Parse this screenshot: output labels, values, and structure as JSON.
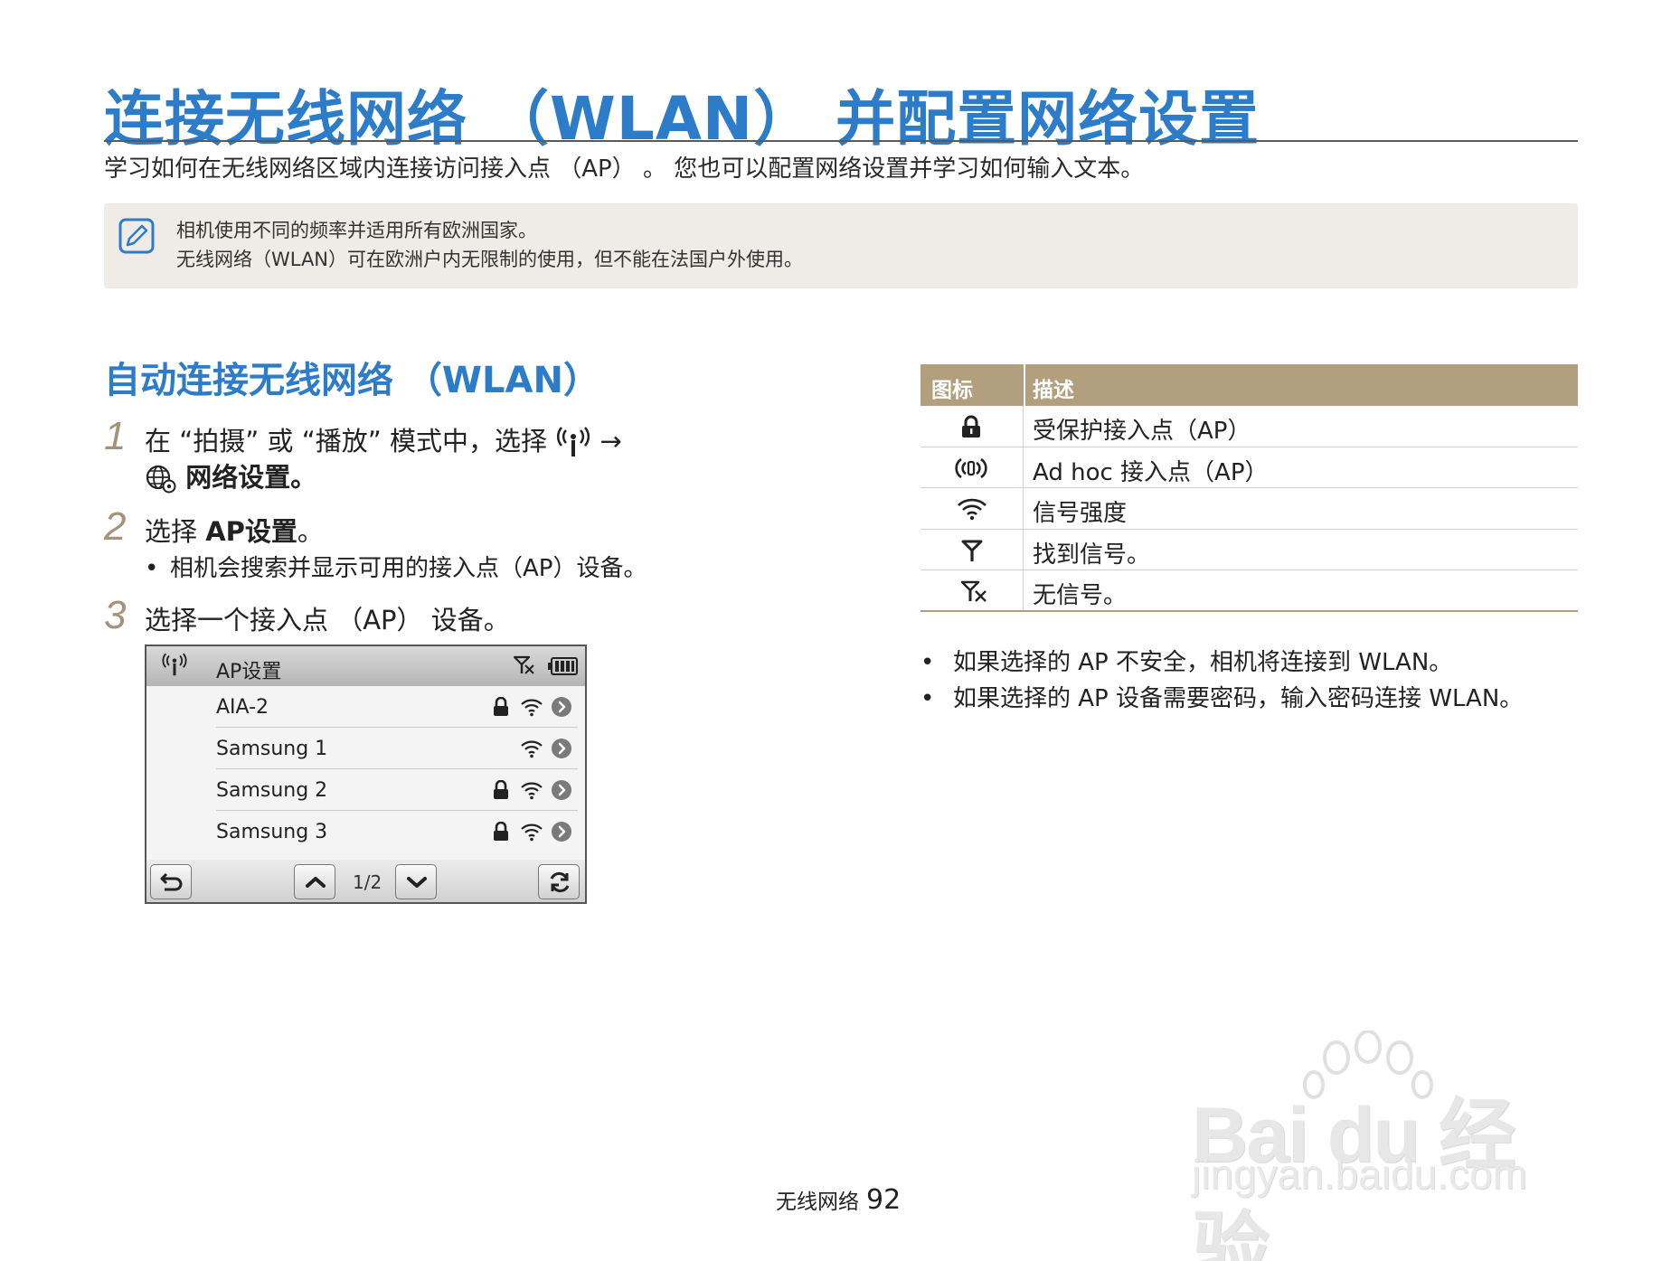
{
  "page": {
    "title": "连接无线网络 （WLAN） 并配置网络设置",
    "subtitle": "学习如何在无线网络区域内连接访问接入点 （AP） 。 您也可以配置网络设置并学习如何输入文本。"
  },
  "note": {
    "icon": "note-pencil-icon",
    "line1": "相机使用不同的频率并适用所有欧洲国家。",
    "line2": "无线网络（WLAN）可在欧洲户内无限制的使用，但不能在法国户外使用。"
  },
  "section": {
    "heading": "自动连接无线网络 （WLAN）"
  },
  "steps": [
    {
      "num": "1",
      "text_a": "在 “拍摄” 或 “播放” 模式中，选择",
      "arrow": "→",
      "text_b": "网络设置。"
    },
    {
      "num": "2",
      "text_prefix": "选择 ",
      "text_bold": "AP设置",
      "text_suffix": "。",
      "bullet": "相机会搜索并显示可用的接入点（AP）设备。"
    },
    {
      "num": "3",
      "text": "选择一个接入点 （AP） 设备。"
    }
  ],
  "camera_screen": {
    "header_title": "AP设置",
    "rows": [
      {
        "name": "AIA-2",
        "locked": true
      },
      {
        "name": "Samsung 1",
        "locked": false
      },
      {
        "name": "Samsung 2",
        "locked": true
      },
      {
        "name": "Samsung 3",
        "locked": true
      }
    ],
    "page_indicator": "1/2"
  },
  "icon_table": {
    "header_icon": "图标",
    "header_desc": "描述",
    "rows": [
      {
        "icon": "lock-icon",
        "desc": "受保护接入点（AP）"
      },
      {
        "icon": "adhoc-icon",
        "desc": "Ad hoc 接入点（AP）"
      },
      {
        "icon": "wifi-signal-icon",
        "desc": "信号强度"
      },
      {
        "icon": "antenna-icon",
        "desc": "找到信号。"
      },
      {
        "icon": "no-signal-icon",
        "desc": "无信号。"
      }
    ]
  },
  "right_bullets": [
    "如果选择的 AP 不安全，相机将连接到 WLAN。",
    "如果选择的 AP 设备需要密码，输入密码连接 WLAN。"
  ],
  "footer": {
    "section": "无线网络",
    "page_number": "92"
  },
  "watermark": {
    "logo": "Bai du 经验",
    "url": "jingyan.baidu.com"
  }
}
